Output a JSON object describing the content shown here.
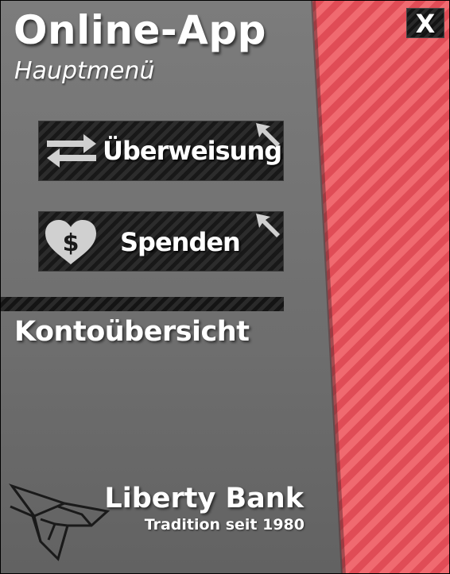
{
  "header": {
    "title": "Online-App",
    "subtitle": "Hauptmenü",
    "close_label": "X"
  },
  "menu": {
    "items": [
      {
        "label": "Überweisung",
        "icon": "transfer-arrows-icon"
      },
      {
        "label": "Spenden",
        "icon": "heart-dollar-icon"
      }
    ]
  },
  "section": {
    "title": "Kontoübersicht"
  },
  "footer": {
    "brand": "Liberty Bank",
    "tagline": "Tradition seit 1980",
    "logo_icon": "bird-logo-icon"
  },
  "colors": {
    "accent_stripe": "#e85a62",
    "panel_gray": "#737373",
    "button_dark": "#1e1e1e",
    "text": "#ffffff"
  }
}
